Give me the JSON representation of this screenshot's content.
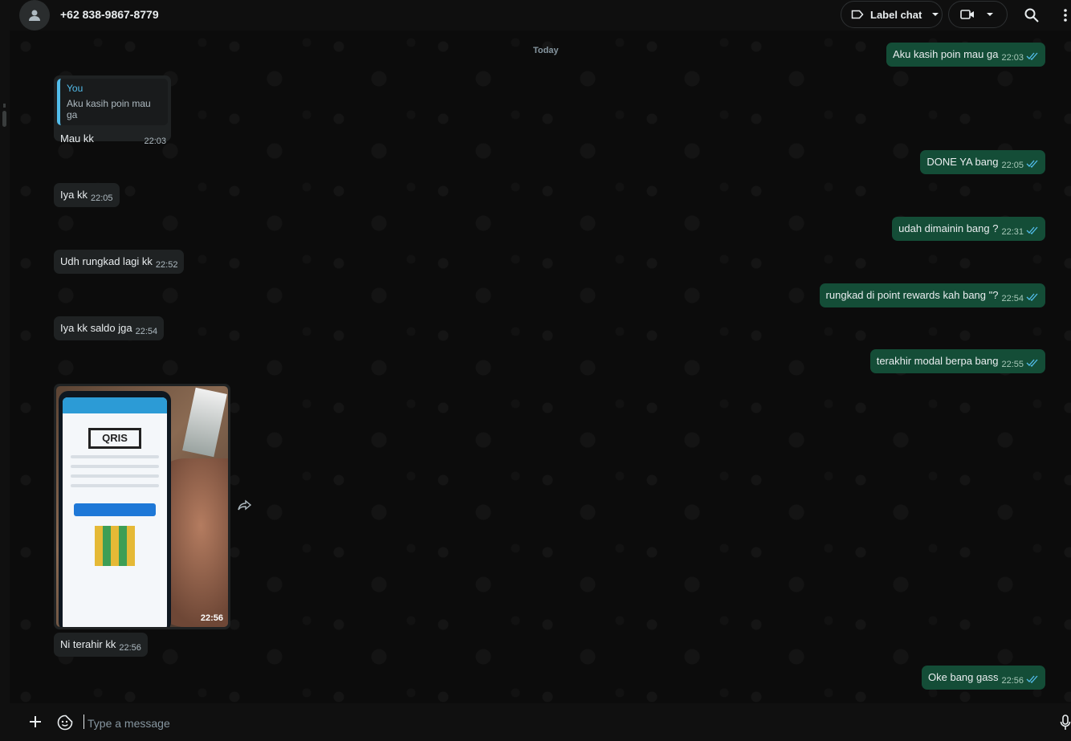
{
  "header": {
    "contact_name": "+62 838-9867-8779",
    "label_chat": "Label chat",
    "icons": [
      "person-icon",
      "label-icon",
      "chevron-down-icon",
      "video-icon",
      "search-icon",
      "kebab-menu-icon"
    ]
  },
  "chat": {
    "date_divider": "Today",
    "messages": [
      {
        "dir": "in",
        "reply_author": "You",
        "reply_text": "Aku kasih poin mau ga",
        "text": "Mau kk",
        "time": "22:03"
      },
      {
        "dir": "in",
        "text": "Iya kk",
        "time": "22:05"
      },
      {
        "dir": "in",
        "text": "Udh rungkad lagi kk",
        "time": "22:52"
      },
      {
        "dir": "in",
        "text": "Iya kk saldo jga",
        "time": "22:54"
      },
      {
        "dir": "in",
        "type": "image",
        "image_time": "22:56",
        "image_desc_logo": "QRIS",
        "text": "Ni terahir kk",
        "time": "22:56"
      },
      {
        "dir": "out",
        "text": "Aku kasih poin mau ga",
        "time": "22:03",
        "status": "read"
      },
      {
        "dir": "out",
        "text": "DONE YA bang",
        "time": "22:05",
        "status": "read"
      },
      {
        "dir": "out",
        "text": "udah dimainin bang ?",
        "time": "22:31",
        "status": "read"
      },
      {
        "dir": "out",
        "text": "rungkad di point rewards kah bang \"?",
        "time": "22:54",
        "status": "read"
      },
      {
        "dir": "out",
        "text": "terakhir modal berpa bang",
        "time": "22:55",
        "status": "read"
      },
      {
        "dir": "out",
        "text": "Oke bang gass",
        "time": "22:56",
        "status": "read"
      }
    ]
  },
  "composer": {
    "placeholder": "Type a message",
    "icons": [
      "plus-icon",
      "sticker-icon",
      "mic-icon"
    ]
  },
  "colors": {
    "incoming_bubble": "#1f2223",
    "outgoing_bubble": "#144d37",
    "read_tick": "#53bdeb",
    "background": "#0b0b0b"
  }
}
